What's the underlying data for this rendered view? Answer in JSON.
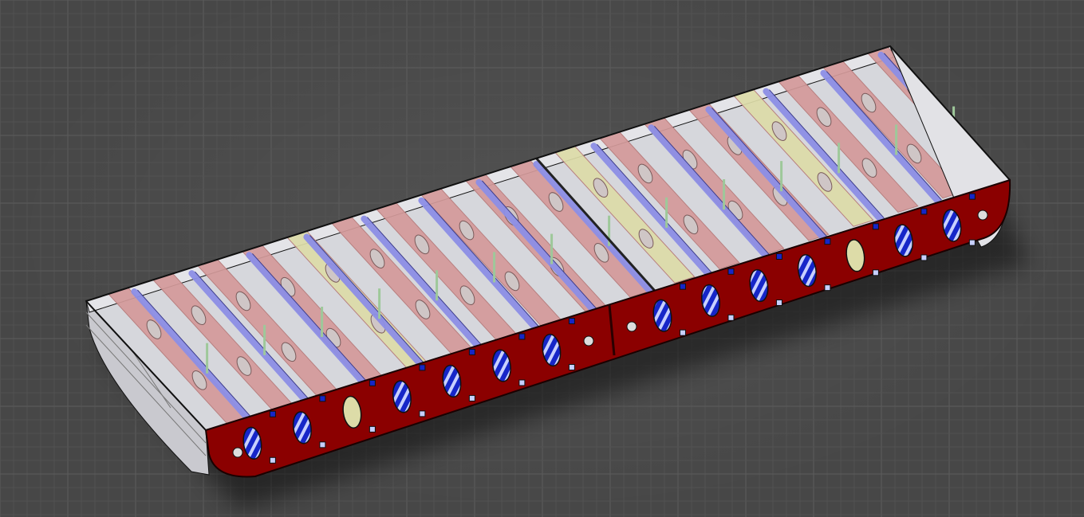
{
  "viewport": {
    "background_color": "#474747",
    "grid_minor_color": "#525252",
    "grid_major_color": "#5c5c5c"
  },
  "model": {
    "name_shown": "",
    "colors": {
      "outer_skin": "#8b0000",
      "outer_skin_edge": "#1a0000",
      "cutout_fill": "#1626c8",
      "cutout_stripe": "#c8d0ff",
      "rib_pink": "#d49a9a",
      "rib_pink_dark": "#b67878",
      "rib_yellow": "#dddca8",
      "stringer_blue": "#8d8fe6",
      "stringer_green": "#9ec89a",
      "deck_grey": "#d6d7dc",
      "inner_wall_grey": "#e4e4e8",
      "edge_line": "#101010"
    },
    "outer_hole_count_left": 7,
    "outer_hole_count_right": 7,
    "rib_count": 18,
    "stringer_count": 14
  }
}
